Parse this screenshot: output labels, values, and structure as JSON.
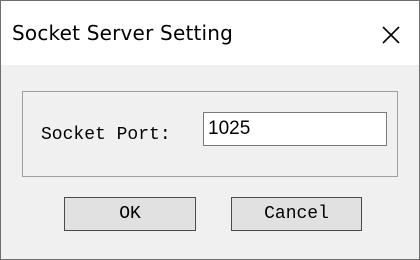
{
  "window": {
    "title": "Socket Server Setting"
  },
  "icons": {
    "close": "close-icon"
  },
  "form": {
    "port_label": "Socket Port:",
    "port_value": "1025"
  },
  "buttons": {
    "ok_label": "OK",
    "cancel_label": "Cancel"
  }
}
